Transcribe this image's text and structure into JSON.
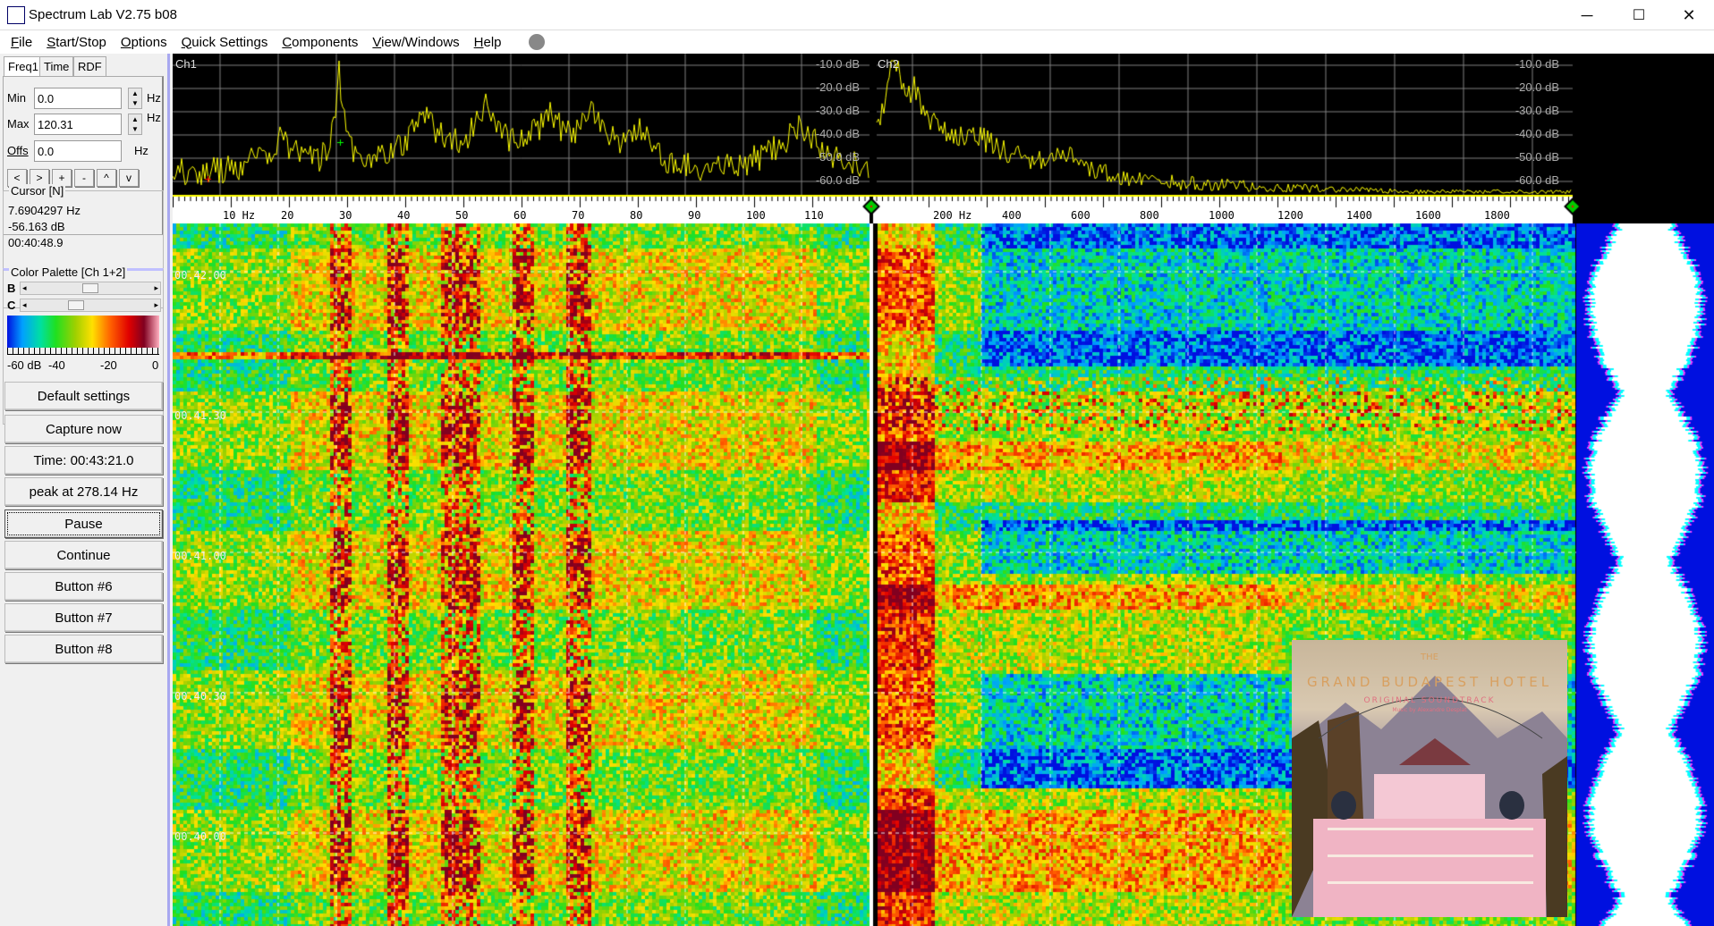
{
  "window": {
    "title": "Spectrum Lab V2.75 b08",
    "minimize": "─",
    "maximize": "☐",
    "close": "✕"
  },
  "menu": [
    "File",
    "Start/Stop",
    "Options",
    "Quick Settings",
    "Components",
    "View/Windows",
    "Help"
  ],
  "tabs": [
    "Freq1",
    "Time",
    "RDF"
  ],
  "freq": {
    "min_label": "Min",
    "min_value": "0.0",
    "max_label": "Max",
    "max_value": "120.31",
    "offs_label": "Offs",
    "offs_value": "0.0",
    "unit": "Hz",
    "nav_buttons": [
      "<",
      ">",
      "+",
      "-",
      "^",
      "v"
    ]
  },
  "cursor": {
    "title": "Cursor [N]",
    "freq": "7.6904297 Hz",
    "level": "-56.163 dB",
    "time": "00:40:48.9"
  },
  "palette": {
    "title": "Color Palette [Ch 1+2]",
    "b_label": "B",
    "c_label": "C",
    "scale": [
      "-60 dB",
      "-40",
      "-20",
      "0"
    ],
    "brightness": 0.5,
    "contrast": 0.35
  },
  "buttons": [
    "Default settings",
    "Capture now",
    "Time:  00:43:21.0",
    "peak at 278.14 Hz",
    "Pause",
    "Continue",
    "Button #6",
    "Button #7",
    "Button #8"
  ],
  "ch1": {
    "label": "Ch1",
    "db_ticks": [
      "-10.0 dB",
      "-20.0 dB",
      "-30.0 dB",
      "-40.0 dB",
      "-50.0 dB",
      "-60.0 dB"
    ],
    "freq_ticks": [
      "10 Hz",
      "20",
      "30",
      "40",
      "50",
      "60",
      "70",
      "80",
      "90",
      "100",
      "110"
    ]
  },
  "ch2": {
    "label": "Ch2",
    "db_ticks": [
      "-10.0 dB",
      "-20.0 dB",
      "-30.0 dB",
      "-40.0 dB",
      "-50.0 dB",
      "-60.0 dB"
    ],
    "freq_ticks": [
      "200 Hz",
      "400",
      "600",
      "800",
      "1000",
      "1200",
      "1400",
      "1600",
      "1800"
    ]
  },
  "time_labels": [
    "00.42.00",
    "00.41.30",
    "00.41.00",
    "00.40.30",
    "00.40.00"
  ],
  "cover": {
    "top": "THE",
    "title": "GRAND BUDAPEST HOTEL",
    "subtitle": "ORIGINAL SOUNDTRACK",
    "credit": "Music by Alexandre Desplat"
  },
  "colors": {
    "trace": "#ffff00",
    "grid": "#808080",
    "waterfall_bg": "#0010e0"
  }
}
